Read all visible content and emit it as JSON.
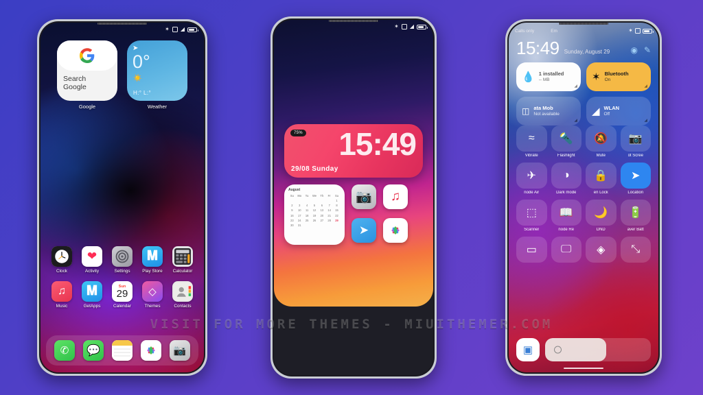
{
  "watermark": "VISIT FOR MORE THEMES - MIUITHEMER.COM",
  "background": {
    "from": "#3b3ec4",
    "to": "#6e41cb"
  },
  "phone1": {
    "statusbar": {
      "bluetooth": "bluetooth-icon",
      "sim": "sim-icon",
      "wifi": "wifi-icon",
      "battery": "battery-icon"
    },
    "widgets": [
      {
        "name": "google",
        "label": "Google",
        "search_line1": "Search",
        "search_line2": "Google"
      },
      {
        "name": "weather",
        "label": "Weather",
        "temp": "0°",
        "highlow": "H:° L:°"
      }
    ],
    "apps_row1": [
      {
        "label": "Clock",
        "icon": "clock-icon"
      },
      {
        "label": "Activity",
        "icon": "heart-icon"
      },
      {
        "label": "Settings",
        "icon": "gear-icon"
      },
      {
        "label": "Play Store",
        "icon": "appstore-icon"
      },
      {
        "label": "Calculator",
        "icon": "calculator-icon"
      }
    ],
    "apps_row2": [
      {
        "label": "Music",
        "icon": "music-icon"
      },
      {
        "label": "GetApps",
        "icon": "appstore-icon"
      },
      {
        "label": "Calendar",
        "icon": "calendar-icon",
        "weekday": "Sun",
        "day": "29"
      },
      {
        "label": "Themes",
        "icon": "themes-icon"
      },
      {
        "label": "Contacts",
        "icon": "contacts-icon"
      }
    ],
    "dock": [
      {
        "label": "Phone",
        "icon": "phone-icon"
      },
      {
        "label": "Messages",
        "icon": "message-icon"
      },
      {
        "label": "Notes",
        "icon": "notes-icon"
      },
      {
        "label": "Photos",
        "icon": "photos-icon"
      },
      {
        "label": "Camera",
        "icon": "camera-icon"
      }
    ],
    "cursor": "hand-cursor-icon"
  },
  "phone2": {
    "statusbar": {
      "bluetooth": "bluetooth-icon",
      "sim": "sim-icon",
      "wifi": "wifi-icon",
      "battery": "battery-icon"
    },
    "clock_widget": {
      "battery": "75%",
      "time": "15:49",
      "date": "29/08 Sunday"
    },
    "calendar_widget": {
      "month": "August",
      "weekdays": [
        "Su",
        "Mo",
        "Tu",
        "We",
        "Th",
        "Fr",
        "Sa"
      ],
      "days": [
        "",
        "",
        "",
        "",
        "",
        "",
        "1",
        "2",
        "3",
        "4",
        "5",
        "6",
        "7",
        "8",
        "9",
        "10",
        "11",
        "12",
        "13",
        "14",
        "15",
        "16",
        "17",
        "18",
        "19",
        "20",
        "21",
        "22",
        "23",
        "24",
        "25",
        "26",
        "27",
        "28",
        "29",
        "30",
        "31",
        "",
        "",
        "",
        "",
        ""
      ],
      "today": "29"
    },
    "apps": [
      {
        "label": "Camera",
        "icon": "camera-icon"
      },
      {
        "label": "Music",
        "icon": "music-icon"
      },
      {
        "label": "Telegram",
        "icon": "telegram-icon"
      },
      {
        "label": "Photos",
        "icon": "photos-icon"
      }
    ]
  },
  "phone3": {
    "statusbar": {
      "left": "Calls only",
      "left2": "Em",
      "bluetooth": "bluetooth-icon",
      "sim": "sim-icon",
      "battery": "battery-icon"
    },
    "header": {
      "time": "15:49",
      "date": "Sunday, August 29",
      "action1": "settings-icon",
      "action2": "edit-icon"
    },
    "big_tiles": [
      {
        "icon": "water-drop-icon",
        "line1": "1 installed",
        "line2": "-- MB",
        "style": "white"
      },
      {
        "icon": "bluetooth-icon",
        "line1": "Bluetooth",
        "line2": "On",
        "style": "amber"
      },
      {
        "icon": "sim-icon",
        "line1": "ata      Mob",
        "line2": "Not available",
        "style": "dim"
      },
      {
        "icon": "wifi-icon",
        "line1": "WLAN",
        "line2": "Off",
        "style": "dim"
      }
    ],
    "tiles": [
      {
        "label": "Vibrate",
        "icon": "vibrate-icon",
        "on": false
      },
      {
        "label": "Flashlight",
        "icon": "flashlight-icon",
        "on": false
      },
      {
        "label": "Mute",
        "icon": "mute-icon",
        "on": false
      },
      {
        "label": "ot   Scree",
        "icon": "camera-icon",
        "on": false
      },
      {
        "label": "node   Air",
        "icon": "airplane-icon",
        "on": false
      },
      {
        "label": "Dark mode",
        "icon": "dark-mode-icon",
        "on": false
      },
      {
        "label": "en   Lock",
        "icon": "lock-icon",
        "on": false
      },
      {
        "label": "Location",
        "icon": "location-icon",
        "on": true
      },
      {
        "label": "Scanner",
        "icon": "scanner-icon",
        "on": false
      },
      {
        "label": "node   Re",
        "icon": "book-icon",
        "on": false
      },
      {
        "label": "DND",
        "icon": "moon-icon",
        "on": false
      },
      {
        "label": "aver   Batt",
        "icon": "battery-saver-icon",
        "on": false
      },
      {
        "label": "",
        "icon": "battery-icon",
        "on": false
      },
      {
        "label": "",
        "icon": "cast-icon",
        "on": false
      },
      {
        "label": "",
        "icon": "nfc-icon",
        "on": false
      },
      {
        "label": "",
        "icon": "expand-icon",
        "on": false
      }
    ],
    "bottom": {
      "app_icon": "app-icon",
      "brightness": "brightness-slider"
    }
  }
}
